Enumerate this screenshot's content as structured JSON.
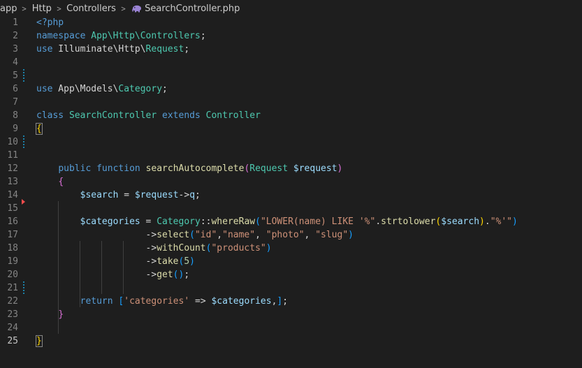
{
  "breadcrumb": {
    "items": [
      "app",
      "Http",
      "Controllers"
    ],
    "file": "SearchController.php",
    "file_icon": "php-elephant-icon"
  },
  "colors": {
    "background": "#1e1e1e",
    "keyword": "#569cd6",
    "class": "#4ec9b0",
    "function": "#dcdcaa",
    "variable": "#9cdcfe",
    "string": "#ce9178",
    "number": "#b5cea8",
    "bracket_level1": "#ffd700",
    "bracket_level2": "#da70d6",
    "bracket_level3": "#179fff",
    "modified_gutter": "#1b81a8",
    "deleted_gutter": "#f14c4c"
  },
  "editor": {
    "active_line": 25,
    "modified_lines": [
      5,
      10,
      21
    ],
    "deleted_lines": [
      14
    ],
    "lines": [
      {
        "n": "1",
        "tokens": [
          [
            "kw",
            "<?php"
          ]
        ]
      },
      {
        "n": "2",
        "tokens": [
          [
            "kw",
            "namespace"
          ],
          [
            "",
            " "
          ],
          [
            "cls",
            "App\\Http\\Controllers"
          ],
          [
            "",
            ";"
          ]
        ]
      },
      {
        "n": "3",
        "tokens": [
          [
            "kw",
            "use"
          ],
          [
            "",
            " Illuminate\\Http\\"
          ],
          [
            "cls",
            "Request"
          ],
          [
            "",
            ";"
          ]
        ]
      },
      {
        "n": "4",
        "tokens": []
      },
      {
        "n": "5",
        "tokens": []
      },
      {
        "n": "6",
        "tokens": [
          [
            "kw",
            "use"
          ],
          [
            "",
            " App\\Models\\"
          ],
          [
            "cls",
            "Category"
          ],
          [
            "",
            ";"
          ]
        ]
      },
      {
        "n": "7",
        "tokens": []
      },
      {
        "n": "8",
        "tokens": [
          [
            "kw",
            "class"
          ],
          [
            "",
            " "
          ],
          [
            "cls",
            "SearchController"
          ],
          [
            "",
            " "
          ],
          [
            "kw",
            "extends"
          ],
          [
            "",
            " "
          ],
          [
            "cls",
            "Controller"
          ]
        ]
      },
      {
        "n": "9",
        "tokens": [
          [
            "br1",
            "{"
          ]
        ]
      },
      {
        "n": "10",
        "tokens": []
      },
      {
        "n": "11",
        "tokens": []
      },
      {
        "n": "12",
        "tokens": [
          [
            "",
            "    "
          ],
          [
            "kw",
            "public"
          ],
          [
            "",
            " "
          ],
          [
            "kw",
            "function"
          ],
          [
            "",
            " "
          ],
          [
            "fn",
            "searchAutocomplete"
          ],
          [
            "br2",
            "("
          ],
          [
            "cls",
            "Request"
          ],
          [
            "",
            " "
          ],
          [
            "var",
            "$request"
          ],
          [
            "br2",
            ")"
          ]
        ]
      },
      {
        "n": "13",
        "tokens": [
          [
            "",
            "    "
          ],
          [
            "br2",
            "{"
          ]
        ]
      },
      {
        "n": "14",
        "tokens": [
          [
            "",
            "        "
          ],
          [
            "var",
            "$search"
          ],
          [
            "",
            " = "
          ],
          [
            "var",
            "$request"
          ],
          [
            "",
            "->"
          ],
          [
            "var",
            "q"
          ],
          [
            "",
            ";"
          ]
        ]
      },
      {
        "n": "15",
        "tokens": []
      },
      {
        "n": "16",
        "tokens": [
          [
            "",
            "        "
          ],
          [
            "var",
            "$categories"
          ],
          [
            "",
            " = "
          ],
          [
            "cls",
            "Category"
          ],
          [
            "",
            "::"
          ],
          [
            "fn",
            "whereRaw"
          ],
          [
            "br3",
            "("
          ],
          [
            "str",
            "\"LOWER(name) LIKE '%\""
          ],
          [
            "",
            "."
          ],
          [
            "fn",
            "strtolower"
          ],
          [
            "br1",
            "("
          ],
          [
            "var",
            "$search"
          ],
          [
            "br1",
            ")"
          ],
          [
            "",
            "."
          ],
          [
            "str",
            "\"%'\""
          ],
          [
            "br3",
            ")"
          ]
        ]
      },
      {
        "n": "17",
        "tokens": [
          [
            "",
            "                    ->"
          ],
          [
            "fn",
            "select"
          ],
          [
            "br3",
            "("
          ],
          [
            "str",
            "\"id\""
          ],
          [
            "",
            ","
          ],
          [
            "str",
            "\"name\""
          ],
          [
            "",
            ", "
          ],
          [
            "str",
            "\"photo\""
          ],
          [
            "",
            ", "
          ],
          [
            "str",
            "\"slug\""
          ],
          [
            "br3",
            ")"
          ]
        ]
      },
      {
        "n": "18",
        "tokens": [
          [
            "",
            "                    ->"
          ],
          [
            "fn",
            "withCount"
          ],
          [
            "br3",
            "("
          ],
          [
            "str",
            "\"products\""
          ],
          [
            "br3",
            ")"
          ]
        ]
      },
      {
        "n": "19",
        "tokens": [
          [
            "",
            "                    ->"
          ],
          [
            "fn",
            "take"
          ],
          [
            "br3",
            "("
          ],
          [
            "num",
            "5"
          ],
          [
            "br3",
            ")"
          ]
        ]
      },
      {
        "n": "20",
        "tokens": [
          [
            "",
            "                    ->"
          ],
          [
            "fn",
            "get"
          ],
          [
            "br3",
            "()"
          ],
          [
            "",
            ";"
          ]
        ]
      },
      {
        "n": "21",
        "tokens": []
      },
      {
        "n": "22",
        "tokens": [
          [
            "",
            "        "
          ],
          [
            "kw",
            "return"
          ],
          [
            "",
            " "
          ],
          [
            "br3",
            "["
          ],
          [
            "str",
            "'categories'"
          ],
          [
            "",
            " => "
          ],
          [
            "var",
            "$categories"
          ],
          [
            "",
            ","
          ],
          [
            "br3",
            "]"
          ],
          [
            "",
            ";"
          ]
        ]
      },
      {
        "n": "23",
        "tokens": [
          [
            "",
            "    "
          ],
          [
            "br2",
            "}"
          ]
        ]
      },
      {
        "n": "24",
        "tokens": []
      },
      {
        "n": "25",
        "tokens": [
          [
            "br1",
            "}"
          ]
        ]
      }
    ]
  }
}
